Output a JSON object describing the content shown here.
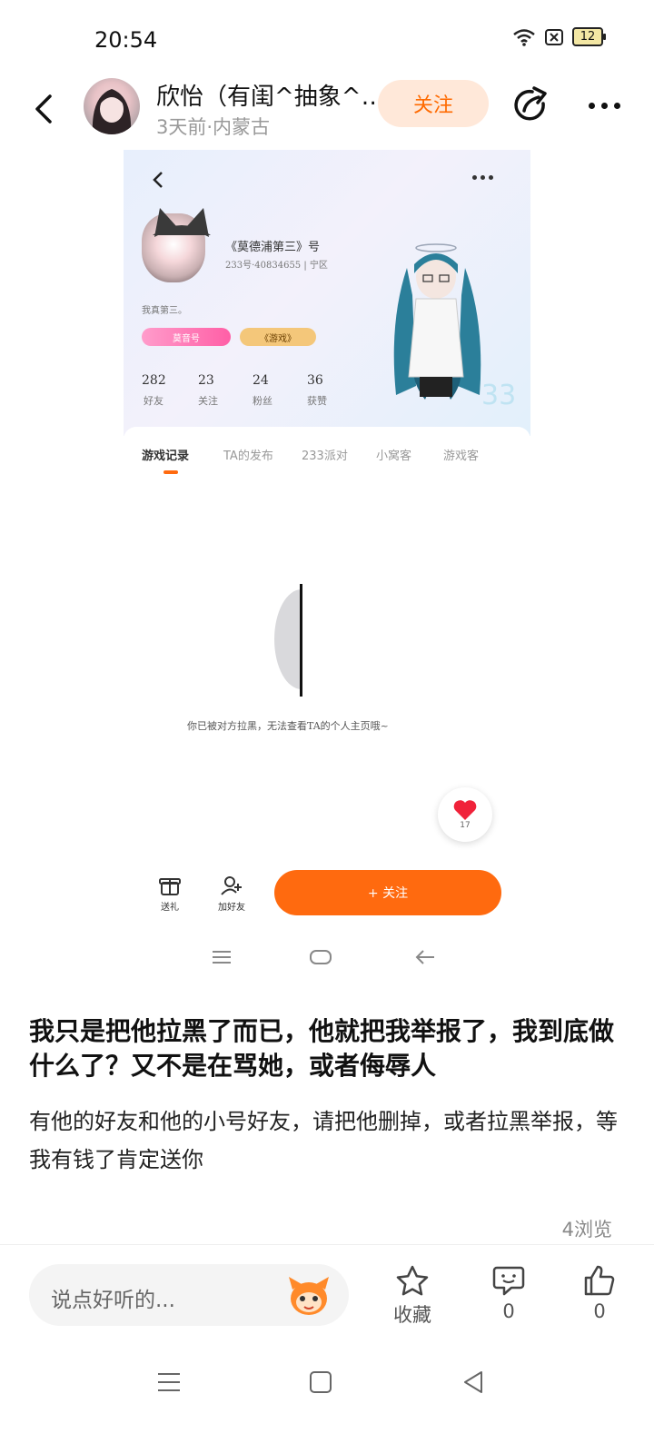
{
  "status_bar": {
    "time": "20:54",
    "battery_level": "12"
  },
  "header": {
    "author_name": "欣怡（有闺^抽象^…",
    "post_meta": "3天前·内蒙古",
    "follow_label": "关注"
  },
  "embedded_screenshot": {
    "profile_name": "《莫德浦第三》号",
    "profile_id": "233号·40834655 | 宁区",
    "bio": "我真第三。",
    "badge_1": "莫音号",
    "badge_2": "《游戏》",
    "stats": [
      {
        "value": "282",
        "label": "好友"
      },
      {
        "value": "23",
        "label": "关注"
      },
      {
        "value": "24",
        "label": "粉丝"
      },
      {
        "value": "36",
        "label": "获赞"
      }
    ],
    "tabs": [
      "游戏记录",
      "TA的发布",
      "233派对",
      "小窝客",
      "游戏客"
    ],
    "blocked_notice": "你已被对方拉黑，无法查看TA的个人主页哦~",
    "heart_count": "17",
    "gift_label": "送礼",
    "add_friend_label": "加好友",
    "follow_button_label": "+ 关注"
  },
  "post": {
    "title": "我只是把他拉黑了而已，他就把我举报了，我到底做什么了？又不是在骂她，或者侮辱人",
    "body": "有他的好友和他的小号好友，请把他删掉，或者拉黑举报，等我有钱了肯定送你",
    "view_count": "4浏览"
  },
  "bottom_bar": {
    "comment_placeholder": "说点好听的...",
    "favorite_label": "收藏",
    "comment_count": "0",
    "like_count": "0"
  }
}
